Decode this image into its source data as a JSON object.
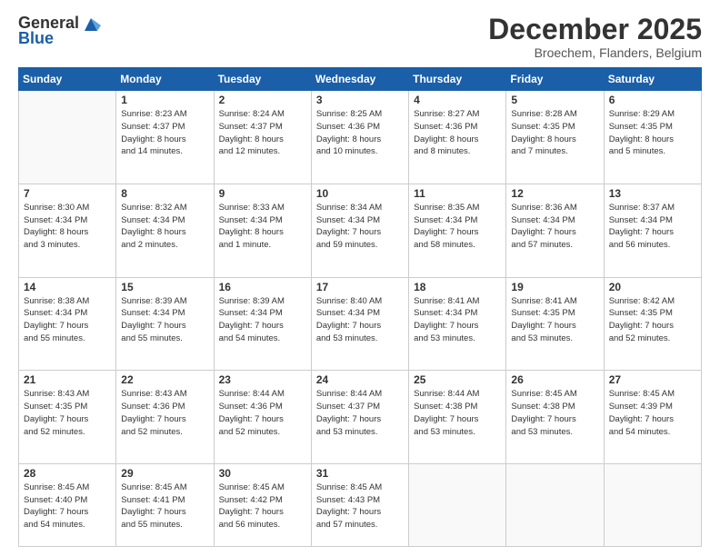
{
  "logo": {
    "general": "General",
    "blue": "Blue"
  },
  "header": {
    "month": "December 2025",
    "location": "Broechem, Flanders, Belgium"
  },
  "days_header": [
    "Sunday",
    "Monday",
    "Tuesday",
    "Wednesday",
    "Thursday",
    "Friday",
    "Saturday"
  ],
  "weeks": [
    [
      {
        "day": "",
        "empty": true
      },
      {
        "day": "1",
        "sunrise": "Sunrise: 8:23 AM",
        "sunset": "Sunset: 4:37 PM",
        "daylight": "Daylight: 8 hours",
        "minutes": "and 14 minutes."
      },
      {
        "day": "2",
        "sunrise": "Sunrise: 8:24 AM",
        "sunset": "Sunset: 4:37 PM",
        "daylight": "Daylight: 8 hours",
        "minutes": "and 12 minutes."
      },
      {
        "day": "3",
        "sunrise": "Sunrise: 8:25 AM",
        "sunset": "Sunset: 4:36 PM",
        "daylight": "Daylight: 8 hours",
        "minutes": "and 10 minutes."
      },
      {
        "day": "4",
        "sunrise": "Sunrise: 8:27 AM",
        "sunset": "Sunset: 4:36 PM",
        "daylight": "Daylight: 8 hours",
        "minutes": "and 8 minutes."
      },
      {
        "day": "5",
        "sunrise": "Sunrise: 8:28 AM",
        "sunset": "Sunset: 4:35 PM",
        "daylight": "Daylight: 8 hours",
        "minutes": "and 7 minutes."
      },
      {
        "day": "6",
        "sunrise": "Sunrise: 8:29 AM",
        "sunset": "Sunset: 4:35 PM",
        "daylight": "Daylight: 8 hours",
        "minutes": "and 5 minutes."
      }
    ],
    [
      {
        "day": "7",
        "sunrise": "Sunrise: 8:30 AM",
        "sunset": "Sunset: 4:34 PM",
        "daylight": "Daylight: 8 hours",
        "minutes": "and 3 minutes."
      },
      {
        "day": "8",
        "sunrise": "Sunrise: 8:32 AM",
        "sunset": "Sunset: 4:34 PM",
        "daylight": "Daylight: 8 hours",
        "minutes": "and 2 minutes."
      },
      {
        "day": "9",
        "sunrise": "Sunrise: 8:33 AM",
        "sunset": "Sunset: 4:34 PM",
        "daylight": "Daylight: 8 hours",
        "minutes": "and 1 minute."
      },
      {
        "day": "10",
        "sunrise": "Sunrise: 8:34 AM",
        "sunset": "Sunset: 4:34 PM",
        "daylight": "Daylight: 7 hours",
        "minutes": "and 59 minutes."
      },
      {
        "day": "11",
        "sunrise": "Sunrise: 8:35 AM",
        "sunset": "Sunset: 4:34 PM",
        "daylight": "Daylight: 7 hours",
        "minutes": "and 58 minutes."
      },
      {
        "day": "12",
        "sunrise": "Sunrise: 8:36 AM",
        "sunset": "Sunset: 4:34 PM",
        "daylight": "Daylight: 7 hours",
        "minutes": "and 57 minutes."
      },
      {
        "day": "13",
        "sunrise": "Sunrise: 8:37 AM",
        "sunset": "Sunset: 4:34 PM",
        "daylight": "Daylight: 7 hours",
        "minutes": "and 56 minutes."
      }
    ],
    [
      {
        "day": "14",
        "sunrise": "Sunrise: 8:38 AM",
        "sunset": "Sunset: 4:34 PM",
        "daylight": "Daylight: 7 hours",
        "minutes": "and 55 minutes."
      },
      {
        "day": "15",
        "sunrise": "Sunrise: 8:39 AM",
        "sunset": "Sunset: 4:34 PM",
        "daylight": "Daylight: 7 hours",
        "minutes": "and 55 minutes."
      },
      {
        "day": "16",
        "sunrise": "Sunrise: 8:39 AM",
        "sunset": "Sunset: 4:34 PM",
        "daylight": "Daylight: 7 hours",
        "minutes": "and 54 minutes."
      },
      {
        "day": "17",
        "sunrise": "Sunrise: 8:40 AM",
        "sunset": "Sunset: 4:34 PM",
        "daylight": "Daylight: 7 hours",
        "minutes": "and 53 minutes."
      },
      {
        "day": "18",
        "sunrise": "Sunrise: 8:41 AM",
        "sunset": "Sunset: 4:34 PM",
        "daylight": "Daylight: 7 hours",
        "minutes": "and 53 minutes."
      },
      {
        "day": "19",
        "sunrise": "Sunrise: 8:41 AM",
        "sunset": "Sunset: 4:35 PM",
        "daylight": "Daylight: 7 hours",
        "minutes": "and 53 minutes."
      },
      {
        "day": "20",
        "sunrise": "Sunrise: 8:42 AM",
        "sunset": "Sunset: 4:35 PM",
        "daylight": "Daylight: 7 hours",
        "minutes": "and 52 minutes."
      }
    ],
    [
      {
        "day": "21",
        "sunrise": "Sunrise: 8:43 AM",
        "sunset": "Sunset: 4:35 PM",
        "daylight": "Daylight: 7 hours",
        "minutes": "and 52 minutes."
      },
      {
        "day": "22",
        "sunrise": "Sunrise: 8:43 AM",
        "sunset": "Sunset: 4:36 PM",
        "daylight": "Daylight: 7 hours",
        "minutes": "and 52 minutes."
      },
      {
        "day": "23",
        "sunrise": "Sunrise: 8:44 AM",
        "sunset": "Sunset: 4:36 PM",
        "daylight": "Daylight: 7 hours",
        "minutes": "and 52 minutes."
      },
      {
        "day": "24",
        "sunrise": "Sunrise: 8:44 AM",
        "sunset": "Sunset: 4:37 PM",
        "daylight": "Daylight: 7 hours",
        "minutes": "and 53 minutes."
      },
      {
        "day": "25",
        "sunrise": "Sunrise: 8:44 AM",
        "sunset": "Sunset: 4:38 PM",
        "daylight": "Daylight: 7 hours",
        "minutes": "and 53 minutes."
      },
      {
        "day": "26",
        "sunrise": "Sunrise: 8:45 AM",
        "sunset": "Sunset: 4:38 PM",
        "daylight": "Daylight: 7 hours",
        "minutes": "and 53 minutes."
      },
      {
        "day": "27",
        "sunrise": "Sunrise: 8:45 AM",
        "sunset": "Sunset: 4:39 PM",
        "daylight": "Daylight: 7 hours",
        "minutes": "and 54 minutes."
      }
    ],
    [
      {
        "day": "28",
        "sunrise": "Sunrise: 8:45 AM",
        "sunset": "Sunset: 4:40 PM",
        "daylight": "Daylight: 7 hours",
        "minutes": "and 54 minutes."
      },
      {
        "day": "29",
        "sunrise": "Sunrise: 8:45 AM",
        "sunset": "Sunset: 4:41 PM",
        "daylight": "Daylight: 7 hours",
        "minutes": "and 55 minutes."
      },
      {
        "day": "30",
        "sunrise": "Sunrise: 8:45 AM",
        "sunset": "Sunset: 4:42 PM",
        "daylight": "Daylight: 7 hours",
        "minutes": "and 56 minutes."
      },
      {
        "day": "31",
        "sunrise": "Sunrise: 8:45 AM",
        "sunset": "Sunset: 4:43 PM",
        "daylight": "Daylight: 7 hours",
        "minutes": "and 57 minutes."
      },
      {
        "day": "",
        "empty": true
      },
      {
        "day": "",
        "empty": true
      },
      {
        "day": "",
        "empty": true
      }
    ]
  ]
}
